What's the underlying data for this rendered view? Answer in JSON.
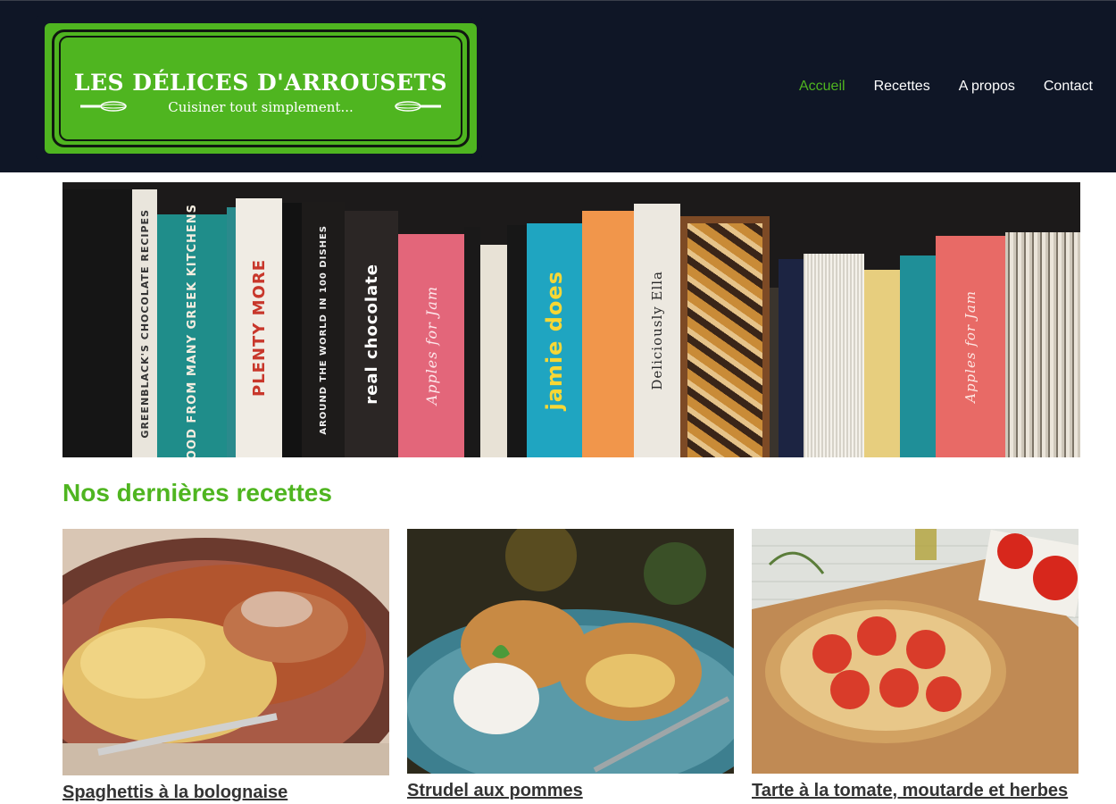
{
  "brand": {
    "title": "LES DÉLICES D'ARROUSETS",
    "tagline": "Cuisiner tout simplement...",
    "colors": {
      "green": "#4fb520",
      "navy": "#0f1626"
    }
  },
  "nav": {
    "items": [
      {
        "label": "Accueil",
        "active": true
      },
      {
        "label": "Recettes",
        "active": false
      },
      {
        "label": "A propos",
        "active": false
      },
      {
        "label": "Contact",
        "active": false
      }
    ]
  },
  "hero": {
    "books": [
      "GREENBLACK'S CHOCOLATE RECIPES",
      "FOOD FROM MANY GREEK KITCHENS",
      "PLENTY MORE",
      "AROUND THE WORLD IN 100 DISHES",
      "real chocolate",
      "Apples for Jam",
      "jamie does",
      "Deliciously Ella",
      "Apples for Jam"
    ]
  },
  "section": {
    "title": "Nos dernières recettes"
  },
  "recipes": [
    {
      "title": "Spaghettis à la bolognaise"
    },
    {
      "title": "Strudel aux pommes"
    },
    {
      "title": "Tarte à la tomate, moutarde et herbes"
    }
  ]
}
